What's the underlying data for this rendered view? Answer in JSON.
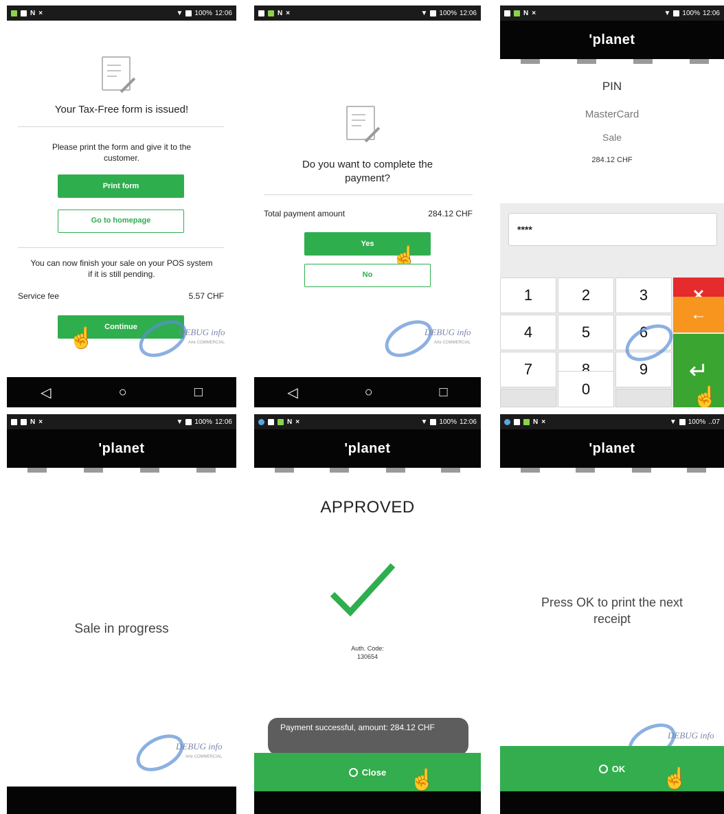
{
  "status": {
    "battery": "100%",
    "time": "12:06",
    "time_truncated": "..07"
  },
  "brand": "'planet",
  "panel1": {
    "heading": "Your Tax-Free form is issued!",
    "instruction": "Please print the form and give it to the customer.",
    "print_label": "Print form",
    "home_label": "Go to homepage",
    "finish_text": "You can now finish your sale on your POS system if it is still pending.",
    "fee_label": "Service fee",
    "fee_value": "5.57 CHF",
    "continue_label": "Continue"
  },
  "panel2": {
    "heading": "Do you want to complete the payment?",
    "total_label": "Total payment amount",
    "total_value": "284.12 CHF",
    "yes_label": "Yes",
    "no_label": "No"
  },
  "panel3": {
    "title": "PIN",
    "card": "MasterCard",
    "type": "Sale",
    "amount": "284.12 CHF",
    "pin_value": "****",
    "keys": [
      "1",
      "2",
      "3",
      "4",
      "5",
      "6",
      "7",
      "8",
      "9",
      "0"
    ],
    "cancel_glyph": "✕",
    "back_glyph": "←",
    "enter_glyph": "↵"
  },
  "panel4": {
    "message": "Sale in progress"
  },
  "panel5": {
    "status": "APPROVED",
    "auth_label": "Auth. Code:",
    "auth_code": "130654",
    "toast": "Payment successful, amount: 284.12 CHF",
    "close_label": "Close"
  },
  "panel6": {
    "message": "Press OK to print the next receipt",
    "ok_label": "OK"
  },
  "watermark": {
    "text": "DEBUG info",
    "sub": "Arte COMMERCIAL"
  },
  "nav": {
    "back": "◁",
    "home": "○",
    "recent": "□"
  },
  "colors": {
    "accent_green": "#2fae4e",
    "cancel_red": "#e52b2b",
    "back_orange": "#f7951e",
    "enter_green": "#3ba531"
  }
}
